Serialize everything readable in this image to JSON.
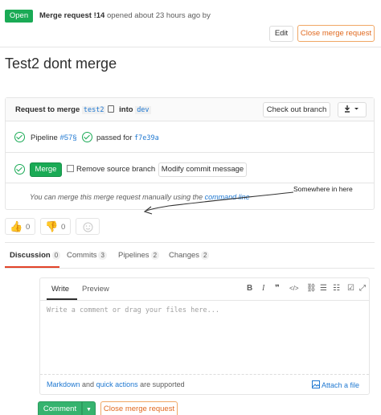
{
  "header": {
    "status_badge": "Open",
    "mr_ref": "Merge request !14",
    "opened_text": "opened about 23 hours ago by",
    "edit_label": "Edit",
    "close_label": "Close merge request"
  },
  "title": "Test2 dont merge",
  "widget": {
    "request_prefix": "Request to merge",
    "source_branch": "test2",
    "into_text": "into",
    "target_branch": "dev",
    "checkout_label": "Check out branch",
    "pipeline_label": "Pipeline",
    "pipeline_id": "#57§",
    "passed_label": "passed for",
    "commit_sha": "f7e39a",
    "merge_label": "Merge",
    "remove_source_label": "Remove source branch",
    "modify_commit_label": "Modify commit message",
    "manual_text": "You can merge this merge request manually using the",
    "manual_link": "command line"
  },
  "annotation": "Somewhere in here",
  "awards": {
    "thumbs_up_count": "0",
    "thumbs_down_count": "0"
  },
  "tabs": [
    {
      "label": "Discussion",
      "count": "0"
    },
    {
      "label": "Commits",
      "count": "3"
    },
    {
      "label": "Pipelines",
      "count": "2"
    },
    {
      "label": "Changes",
      "count": "2"
    }
  ],
  "editor": {
    "write_tab": "Write",
    "preview_tab": "Preview",
    "placeholder": "Write a comment or drag your files here...",
    "markdown_link": "Markdown",
    "and_text": "and",
    "quick_actions_link": "quick actions",
    "supported_text": "are supported",
    "attach_label": "Attach a file"
  },
  "footer": {
    "comment_label": "Comment",
    "close_label": "Close merge request"
  },
  "colors": {
    "success": "#1aaa55",
    "link": "#1f78d1",
    "warning": "#e0691f",
    "active_tab": "#e24329"
  }
}
